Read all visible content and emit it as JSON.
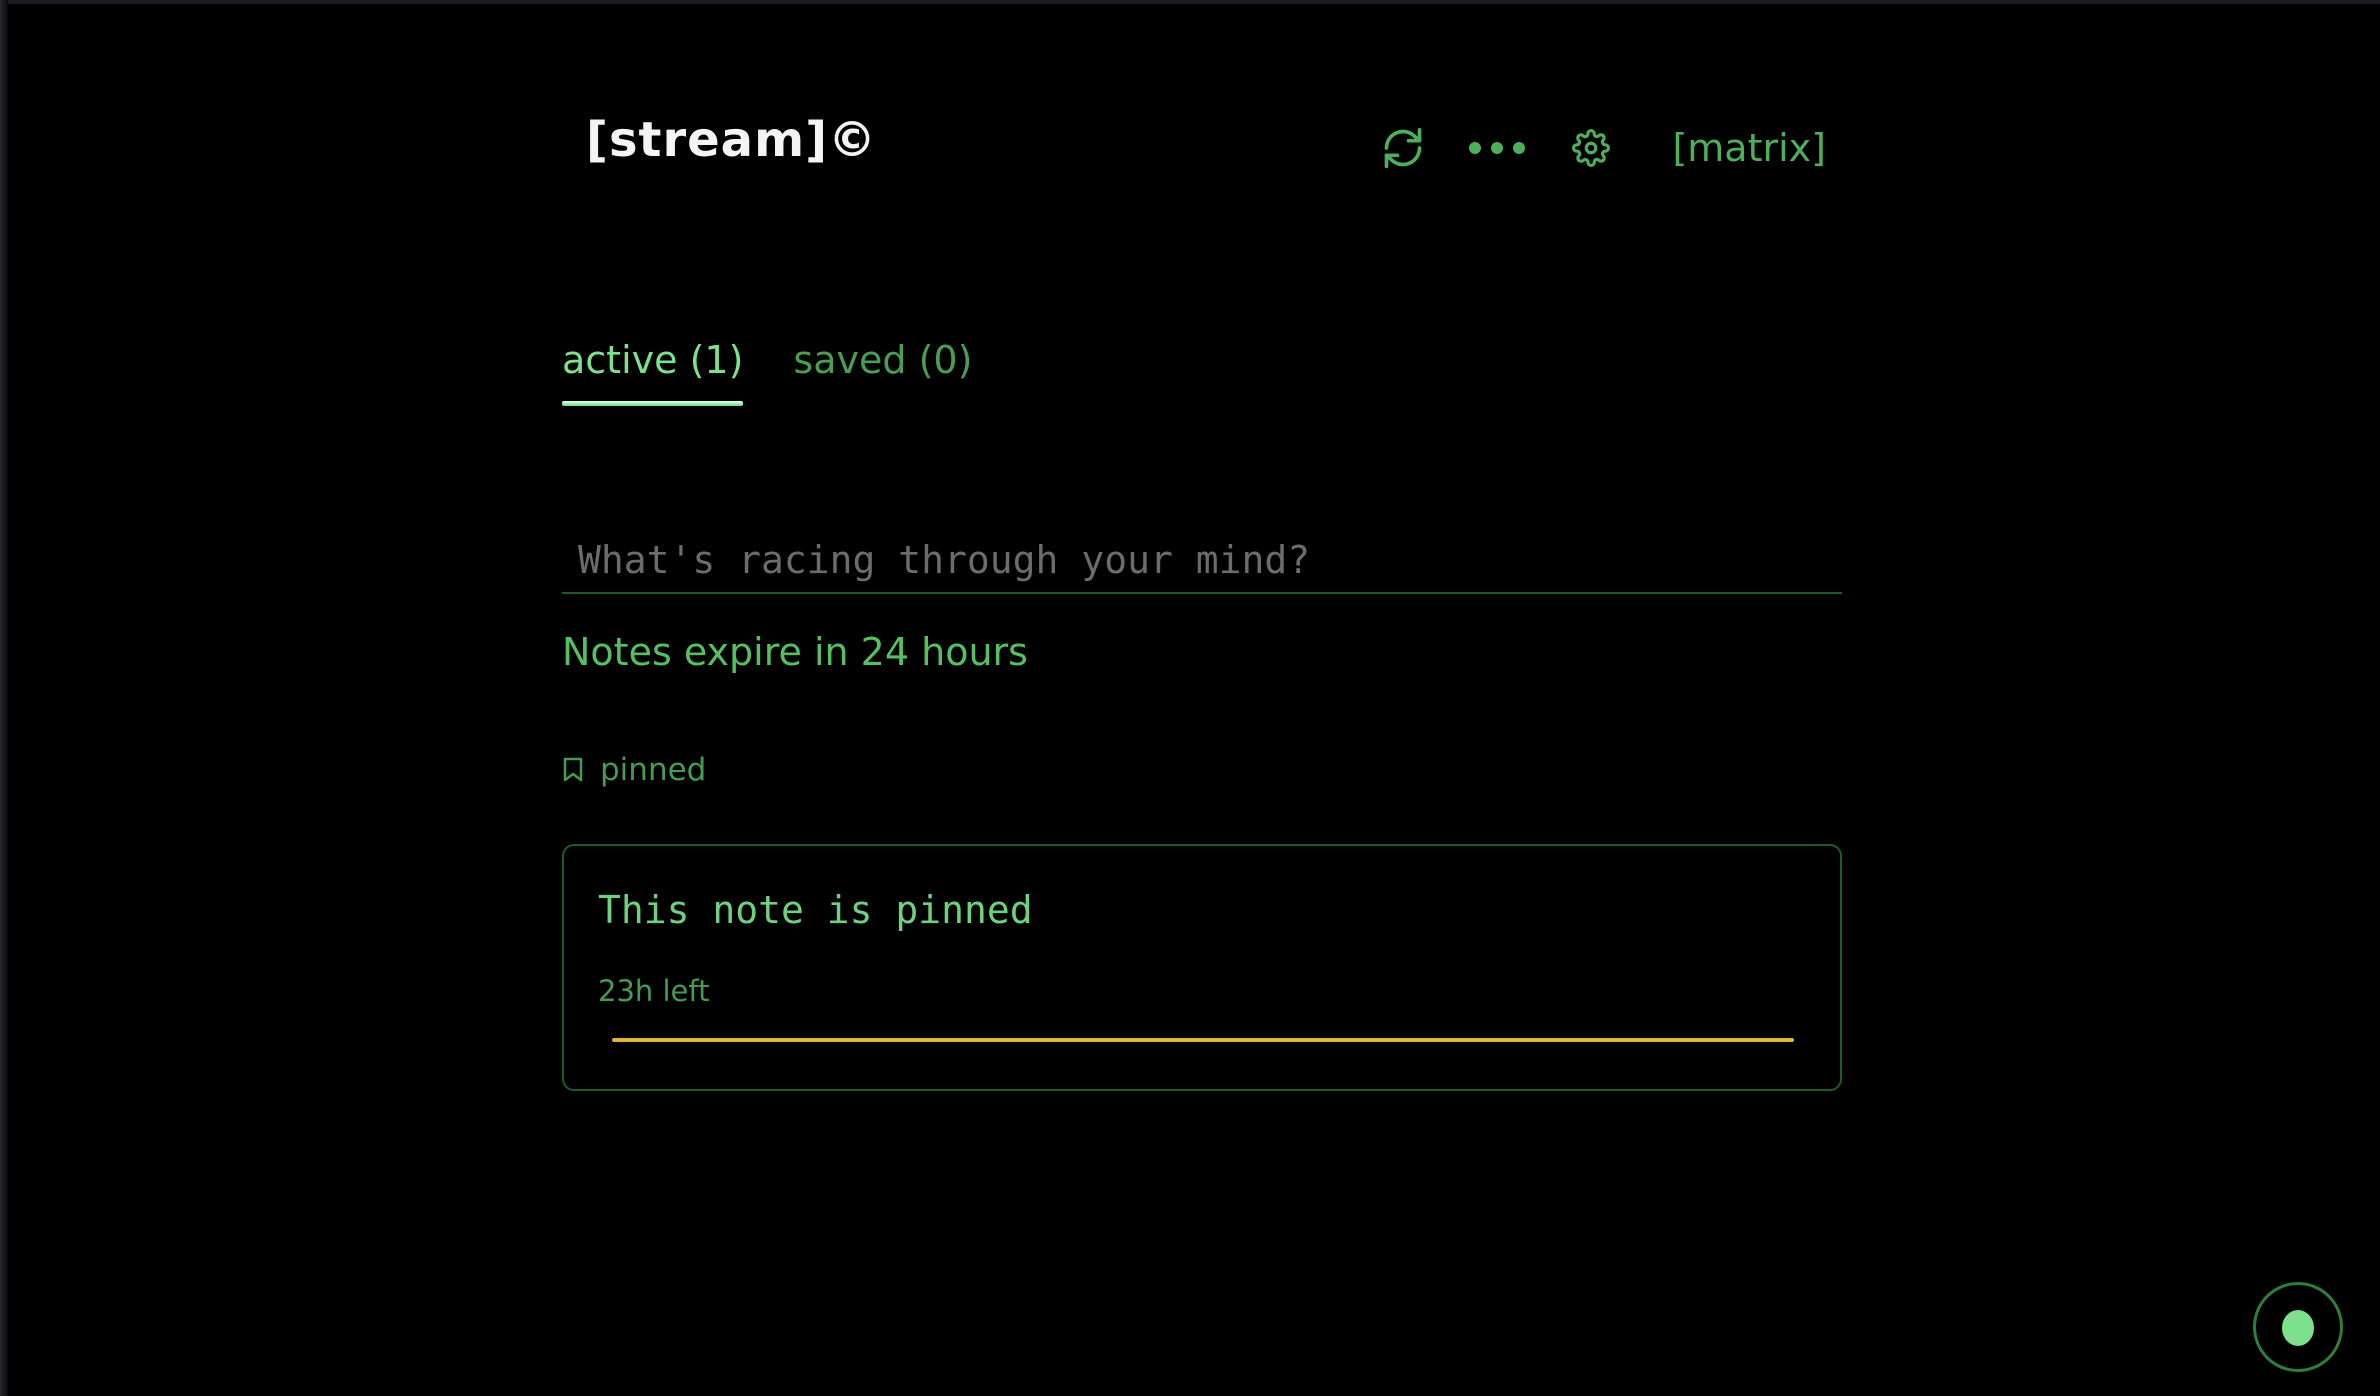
{
  "header": {
    "brand": "[stream]©",
    "matrix_label": "[matrix]"
  },
  "icons": {
    "refresh": "refresh-icon",
    "more": "more-dots-icon",
    "settings": "gear-icon",
    "pin": "bookmark-icon",
    "fab": "droplet-icon"
  },
  "tabs": [
    {
      "label": "active (1)",
      "active": true
    },
    {
      "label": "saved (0)",
      "active": false
    }
  ],
  "composer": {
    "placeholder": "What's racing through your mind?",
    "value": "",
    "hint": "Notes expire in 24 hours"
  },
  "pinned_section": {
    "label": "pinned"
  },
  "notes": [
    {
      "text": "This note is pinned",
      "time_left": "23h left",
      "remaining_fraction": 1.0
    }
  ],
  "colors": {
    "accent": "#4fae59",
    "accent_bright": "#7ce08c",
    "border": "#1f5a28",
    "progress": "#e0b33c",
    "background": "#000000"
  }
}
